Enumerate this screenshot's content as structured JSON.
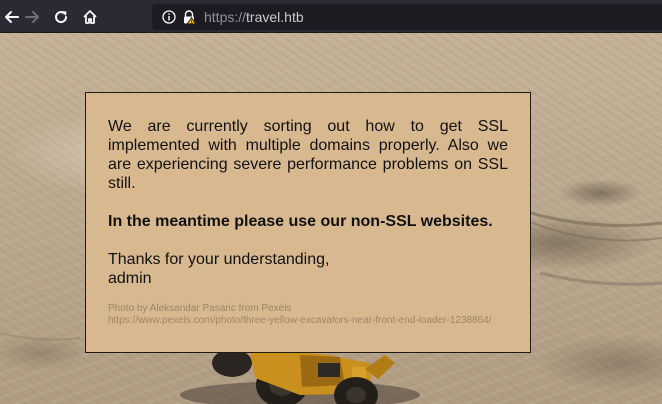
{
  "browser": {
    "url_scheme": "https://",
    "url_host": "travel.htb",
    "icons": [
      "back-arrow",
      "forward-arrow",
      "reload",
      "home",
      "info-circle",
      "insecure-lock-warning"
    ]
  },
  "notice": {
    "paragraph": "We are currently sorting out how to get SSL implemented with multiple domains properly. Also we are experiencing severe performance problems on SSL still.",
    "emphasis": "In the meantime please use our non-SSL websites.",
    "thanks": "Thanks for your understanding,",
    "signature": "admin",
    "photo_credit": "Photo by Aleksandar Pasaric from Pexels",
    "photo_url": "https://www.pexels.com/photo/three-yellow-excavators-near-front-end-loader-1238864/"
  },
  "colors": {
    "toolbar": "#2b2a33",
    "urlbar": "#1c1b22",
    "box_background": "#d8b98f",
    "credit_text": "#9a8566"
  }
}
